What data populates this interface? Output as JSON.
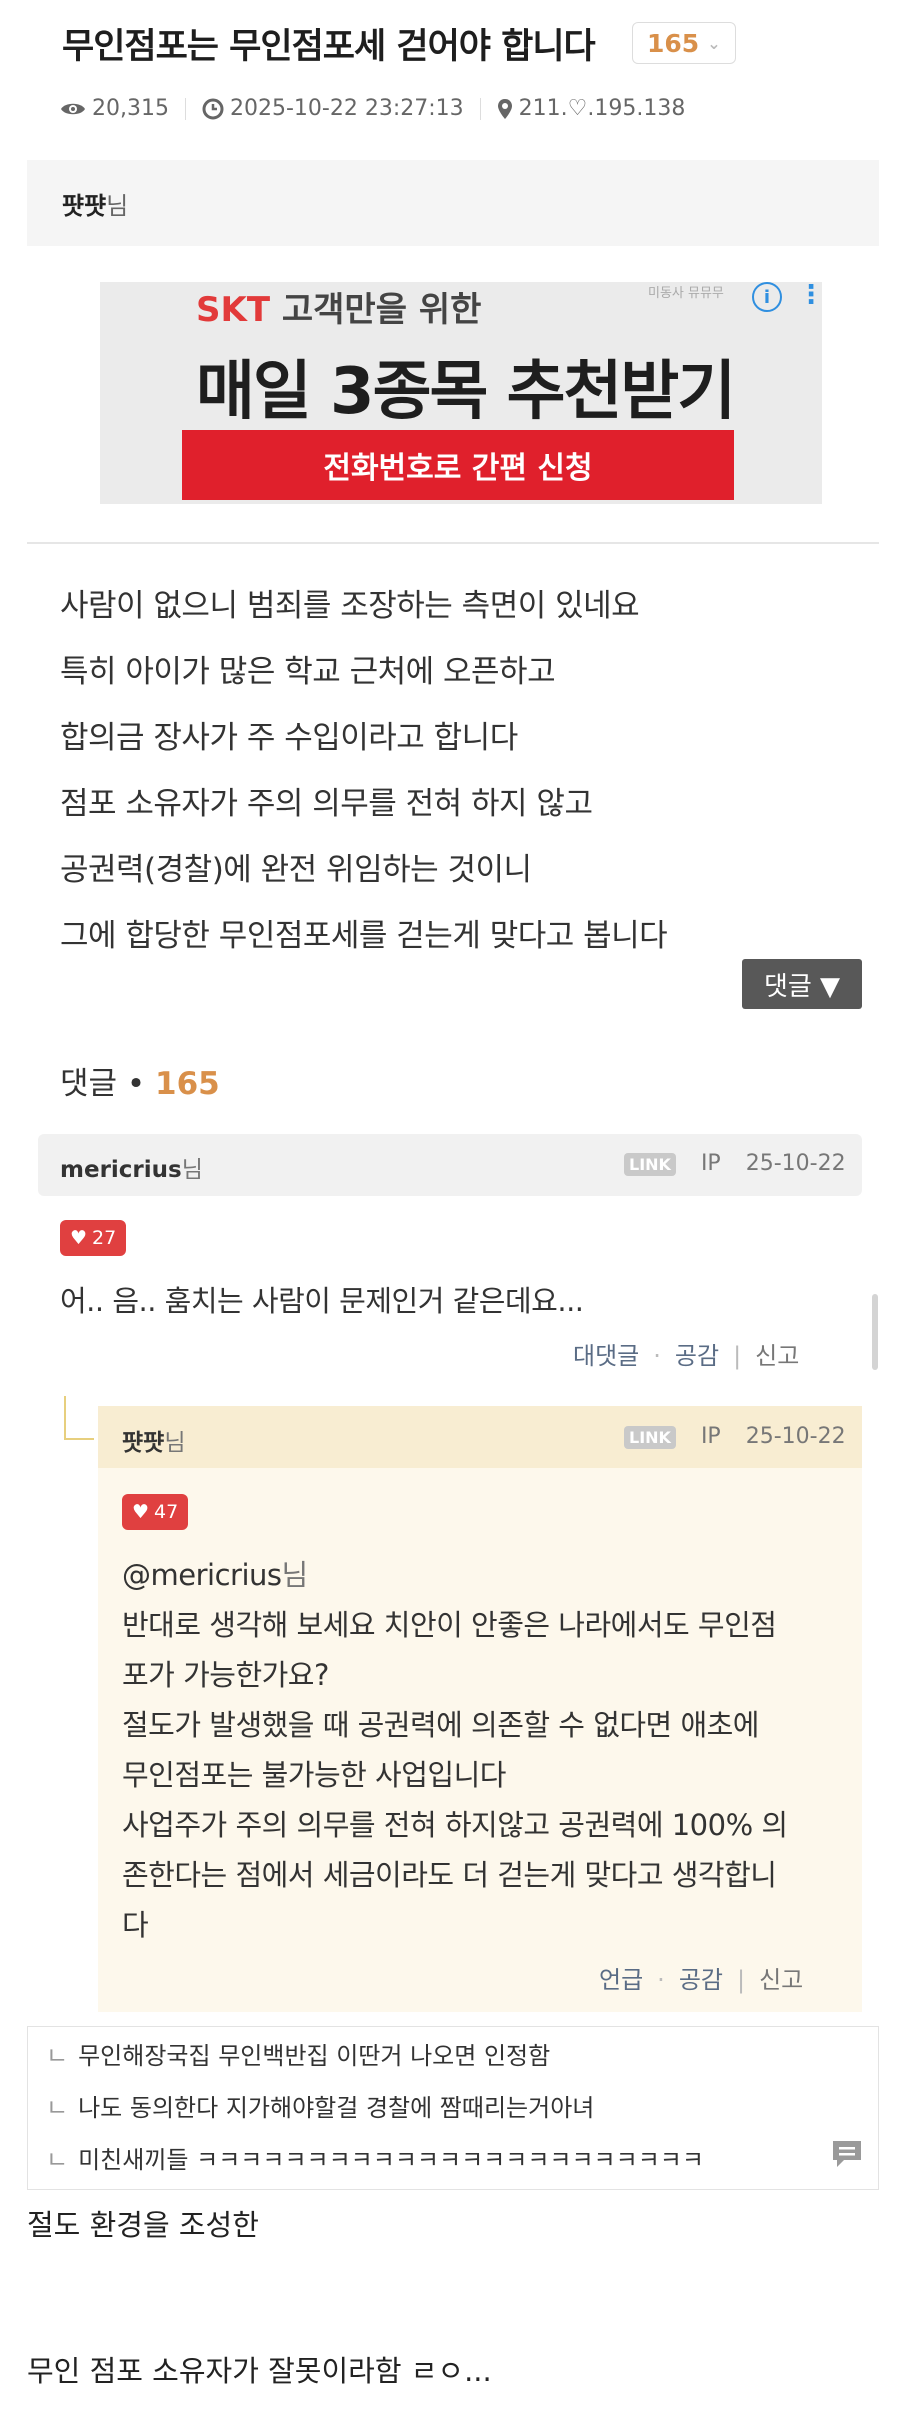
{
  "post": {
    "title": "무인점포는 무인점포세 걷어야 합니다",
    "comment_count": "165",
    "views": "20,315",
    "datetime": "2025-10-22 23:27:13",
    "ip": "211.♡.195.138",
    "author": "퍗퍗",
    "author_suffix": "님",
    "body_lines": [
      "사람이 없으니 범죄를 조장하는 측면이 있네요",
      "특히 아이가 많은 학교 근처에 오픈하고",
      "합의금 장사가 주 수입이라고 합니다",
      "점포 소유자가 주의 의무를 전혀 하지 않고",
      "공권력(경찰)에 완전 위임하는 것이니",
      "그에 합당한 무인점포세를 걷는게 맞다고 봅니다"
    ]
  },
  "ad": {
    "tag": "미동사 뮤뮤무",
    "brand": "SKT",
    "subtitle_rest": " 고객만을 위한",
    "headline": "매일 3종목 추천받기",
    "button": "전화번호로 간편 신청",
    "info_icon": "i",
    "more_icon": "⋮"
  },
  "comments_toggle": "댓글 ▼",
  "comments_header": {
    "label": "댓글 • ",
    "count": "165"
  },
  "comment1": {
    "user": "mericrius",
    "suffix": "님",
    "link": "LINK",
    "ip": "IP",
    "date": "25-10-22",
    "likes": "27",
    "text": "어.. 음.. 훔치는 사람이 문제인거 같은데요...",
    "actions": [
      "대댓글",
      "공감",
      "신고"
    ]
  },
  "reply": {
    "user": "퍗퍗",
    "suffix": "님",
    "link": "LINK",
    "ip": "IP",
    "date": "25-10-22",
    "likes": "47",
    "mention": "@mericrius",
    "mention_suffix": "님",
    "lines": [
      "반대로 생각해 보세요 치안이 안좋은 나라에서도 무인점",
      "포가 가능한가요?",
      "절도가 발생했을 때 공권력에 의존할 수 없다면 애초에",
      "무인점포는 불가능한 사업입니다",
      "사업주가 주의 의무를 전혀 하지않고 공권력에 100% 의",
      "존한다는 점에서 세금이라도 더 걷는게 맞다고 생각합니",
      "다"
    ],
    "actions": [
      "언급",
      "공감",
      "신고"
    ]
  },
  "sub_comments": [
    "무인해장국집 무인백반집 이딴거 나오면 인정함",
    "나도 동의한다 지가해야할걸 경찰에 짬때리는거아녀",
    "미친새끼들 ㅋㅋㅋㅋㅋㅋㅋㅋㅋㅋㅋㅋㅋㅋㅋㅋㅋㅋㅋㅋㅋㅋㅋ"
  ],
  "sub_arrow": "ㄴ",
  "tail_lines": [
    "절도 환경을 조성한",
    "무인 점포 소유자가 잘못이라함 ㄹㅇ..."
  ],
  "colors": {
    "accent": "#d9904a",
    "heart": "#e04040",
    "ad_button": "#e0202c"
  }
}
